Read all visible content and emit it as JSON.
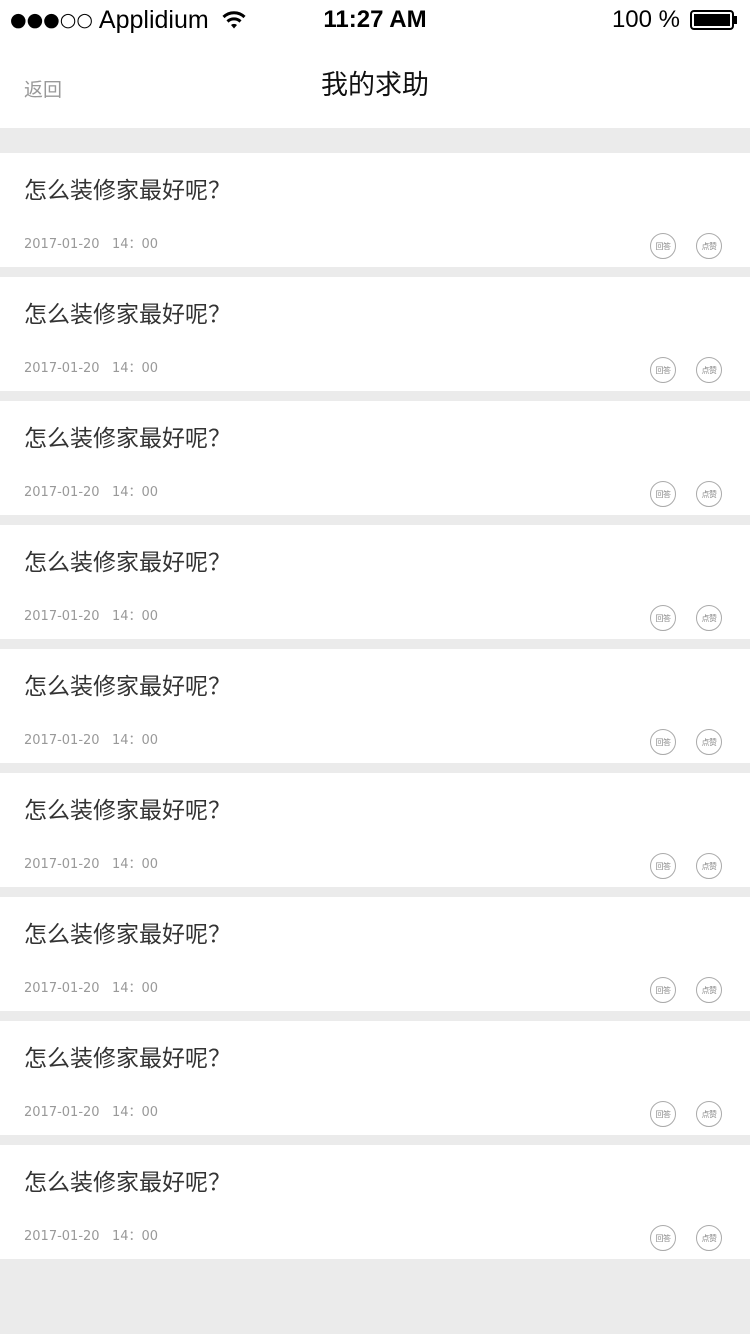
{
  "status_bar": {
    "carrier": "Applidium",
    "signal": "●●●○○",
    "time": "11:27 AM",
    "battery_percent": "100 %",
    "wifi_icon": "wifi-icon",
    "battery_icon": "battery-full-icon"
  },
  "nav": {
    "back_label": "返回",
    "title": "我的求助"
  },
  "items": [
    {
      "title": "怎么装修家最好呢？",
      "time": "2017-01-20   14：00",
      "answer_label": "回答",
      "like_label": "点赞"
    },
    {
      "title": "怎么装修家最好呢？",
      "time": "2017-01-20   14：00",
      "answer_label": "回答",
      "like_label": "点赞"
    },
    {
      "title": "怎么装修家最好呢？",
      "time": "2017-01-20   14：00",
      "answer_label": "回答",
      "like_label": "点赞"
    },
    {
      "title": "怎么装修家最好呢？",
      "time": "2017-01-20   14：00",
      "answer_label": "回答",
      "like_label": "点赞"
    },
    {
      "title": "怎么装修家最好呢？",
      "time": "2017-01-20   14：00",
      "answer_label": "回答",
      "like_label": "点赞"
    },
    {
      "title": "怎么装修家最好呢？",
      "time": "2017-01-20   14：00",
      "answer_label": "回答",
      "like_label": "点赞"
    },
    {
      "title": "怎么装修家最好呢？",
      "time": "2017-01-20   14：00",
      "answer_label": "回答",
      "like_label": "点赞"
    },
    {
      "title": "怎么装修家最好呢？",
      "time": "2017-01-20   14：00",
      "answer_label": "回答",
      "like_label": "点赞"
    },
    {
      "title": "怎么装修家最好呢？",
      "time": "2017-01-20   14：00",
      "answer_label": "回答",
      "like_label": "点赞"
    }
  ]
}
